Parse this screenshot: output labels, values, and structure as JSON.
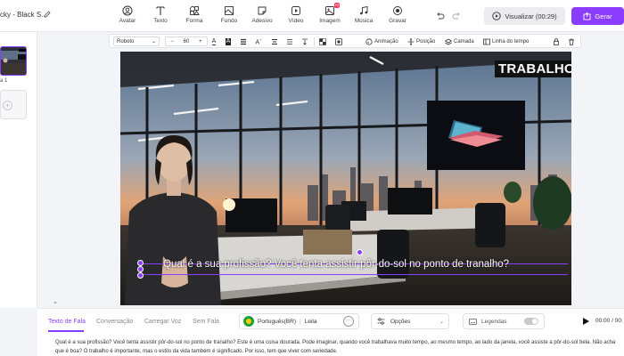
{
  "header": {
    "project_title": "cky - Black S...",
    "tools": [
      {
        "label": "Avatar",
        "icon": "avatar-icon"
      },
      {
        "label": "Texto",
        "icon": "text-icon"
      },
      {
        "label": "Forma",
        "icon": "shape-icon"
      },
      {
        "label": "Fundo",
        "icon": "background-icon"
      },
      {
        "label": "Adesivo",
        "icon": "sticker-icon"
      },
      {
        "label": "Vídeo",
        "icon": "video-icon"
      },
      {
        "label": "Imagem",
        "icon": "image-icon",
        "badge": "AI"
      },
      {
        "label": "Música",
        "icon": "music-icon"
      },
      {
        "label": "Gravar",
        "icon": "record-icon"
      }
    ],
    "preview_label": "Visualizar (00:29)",
    "generate_label": "Gerar"
  },
  "scenes": {
    "items": [
      {
        "label": "a 1"
      }
    ]
  },
  "format_toolbar": {
    "font": "Roboto",
    "font_size": "60",
    "actions": [
      {
        "label": "Animação",
        "icon": "animation-icon"
      },
      {
        "label": "Posição",
        "icon": "position-icon"
      },
      {
        "label": "Camada",
        "icon": "layer-icon"
      },
      {
        "label": "Linha do tempo",
        "icon": "timeline-icon"
      }
    ]
  },
  "canvas": {
    "title_text": "TRABALHO",
    "subtitle": "Qual é a sua profissão? Você tenta assistir pôr-do-sol no ponto de tranalho?"
  },
  "bottom": {
    "tabs": [
      {
        "label": "Texto de Fala",
        "active": true
      },
      {
        "label": "Conversação",
        "active": false
      },
      {
        "label": "Carregar Voz",
        "active": false
      },
      {
        "label": "Sem Fala",
        "active": false
      }
    ],
    "voice_language": "Português(BR)",
    "voice_name": "Leila",
    "options_label": "Opções",
    "captions_label": "Legendas",
    "time": "00:00 / 00:",
    "script": "Qual é a sua profissão? Você tenta assistir pôr-do-sol no ponto de tranalho? Este é uma coisa dourada. Pode imaginar, quando você trabalhava muito tempo, ao mesmo tempo, ao lado da janela, você assiste a pôr-do-sol bela. Não acha que é boa? O trabalho é importante, mas o estilo da vida também é significado. Por isso, tem que viver com seriedade."
  },
  "colors": {
    "accent": "#8b3dff",
    "badge": "#ff3b5c"
  }
}
